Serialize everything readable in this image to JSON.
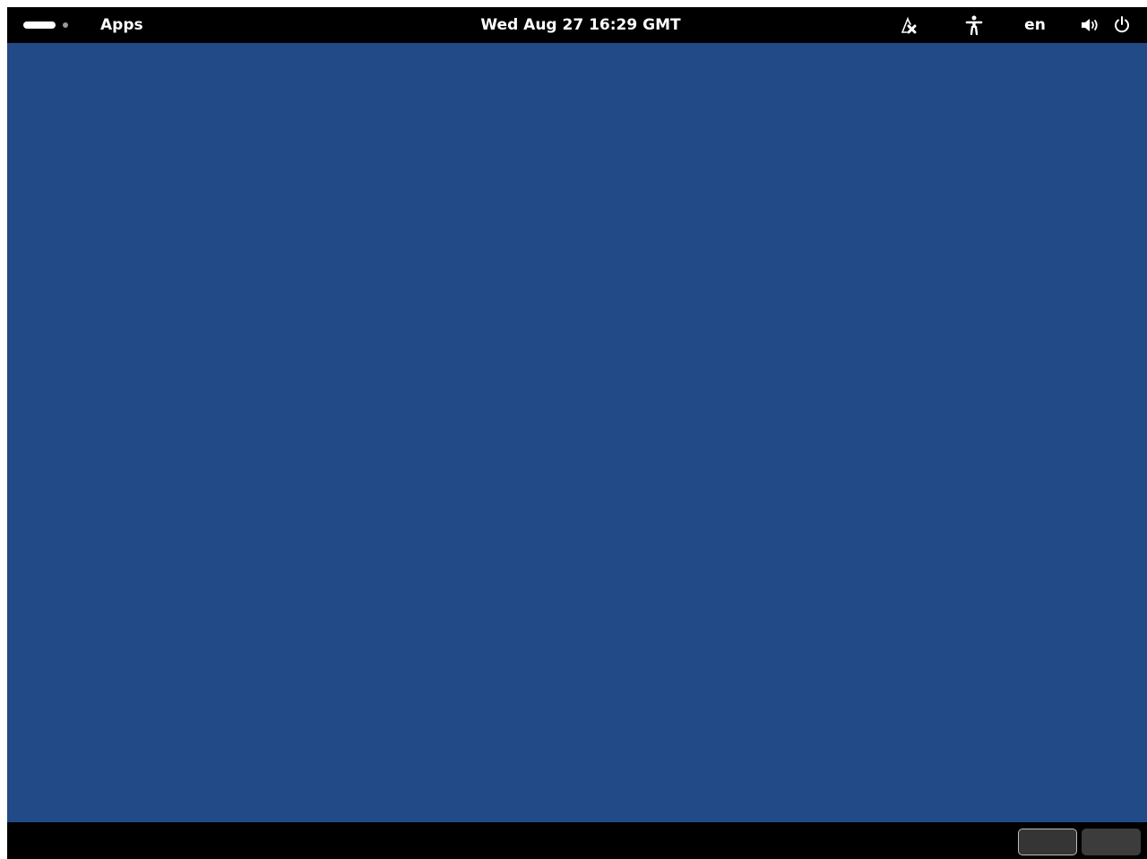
{
  "top_bar": {
    "activities_icon": "activities-pill-icon",
    "apps_label": "Apps",
    "clock_text": "Wed Aug 27  16:29 GMT",
    "indicators": {
      "network_icon": "network-disconnected-icon",
      "accessibility_icon": "accessibility-icon",
      "keyboard_language": "en",
      "volume_icon": "volume-icon",
      "power_icon": "power-icon"
    }
  },
  "desktop": {
    "background_color": "#214a87"
  },
  "bottom_bar": {
    "workspaces": [
      {
        "active": true
      },
      {
        "active": false
      }
    ]
  }
}
